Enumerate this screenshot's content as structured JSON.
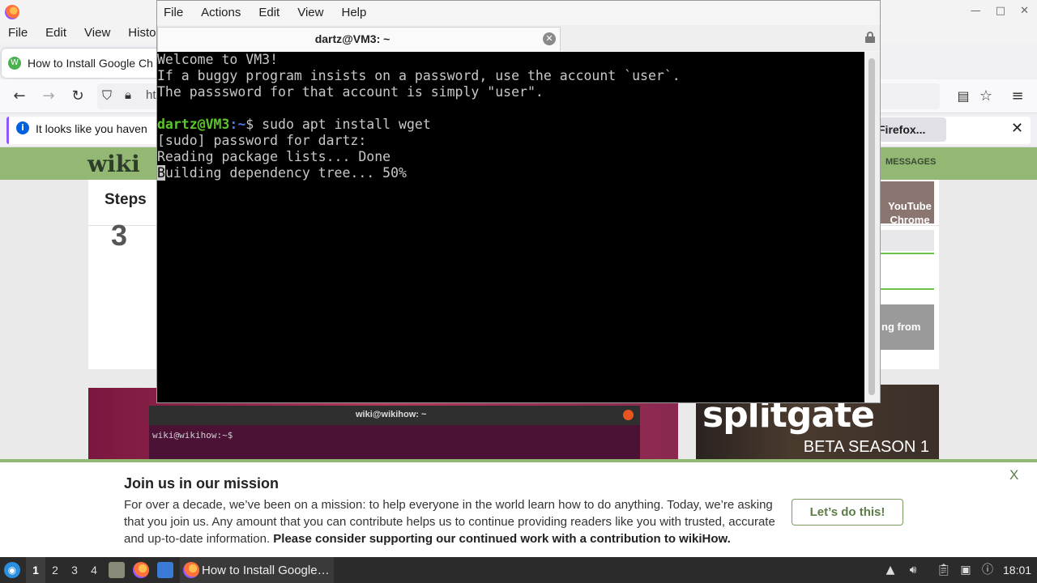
{
  "firefox": {
    "menus": [
      "File",
      "Edit",
      "View",
      "Histo"
    ],
    "tab_title": "How to Install Google Ch",
    "url_partial": "ht",
    "notice_text": "It looks like you haven",
    "notice_button": "Firefox...",
    "notice_close": "✕"
  },
  "wikihow": {
    "logo": "wiki",
    "messages_label": "MESSAGES",
    "steps_heading": "Steps",
    "step_number": "3",
    "side_1": "YouTube Chrome",
    "side_3": "ng from",
    "video_terminal_title": "wiki@wikihow: ~",
    "video_terminal_prompt": "wiki@wikihow:~$",
    "ad_logo": "splitgate",
    "ad_sub": "BETA SEASON 1"
  },
  "donate": {
    "title": "Join us in our mission",
    "body": "For over a decade, we’ve been on a mission: to help everyone in the world learn how to do anything. Today, we’re asking that you join us. Any amount that you can contribute helps us to continue providing readers like you with trusted, accurate and up-to-date information.",
    "body_bold": "Please consider supporting our continued work with a contribution to wikiHow.",
    "button": "Let’s do this!",
    "close": "X"
  },
  "terminal": {
    "menus": [
      "File",
      "Actions",
      "Edit",
      "View",
      "Help"
    ],
    "tab_title": "dartz@VM3: ~",
    "lines": {
      "l1": "Welcome to VM3!",
      "l2": "If a buggy program insists on a password, use the account `user`.",
      "l3": "The passsword for that account is simply \"user\".",
      "prompt_user": "dartz@VM3",
      "prompt_path": ":~",
      "prompt_cmd": "$ sudo apt install wget",
      "l5": "[sudo] password for dartz:",
      "l6": "Reading package lists... Done",
      "l7_cursor": "B",
      "l7_rest": "uilding dependency tree... 50%"
    }
  },
  "taskbar": {
    "workspaces": [
      "1",
      "2",
      "3",
      "4"
    ],
    "active_workspace": "1",
    "task_label": "How to Install Google…",
    "clock": "18:01"
  }
}
